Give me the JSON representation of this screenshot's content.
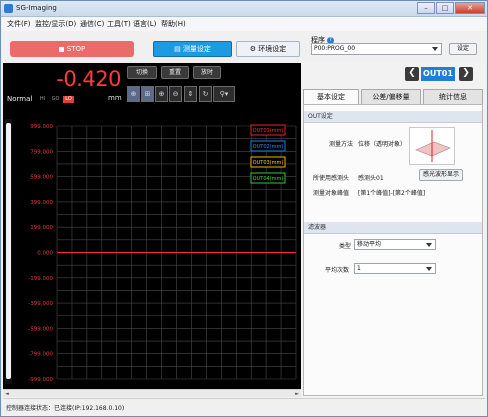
{
  "window": {
    "title": "SG-Imaging",
    "min": "–",
    "max": "□",
    "close": "✕"
  },
  "menu": [
    "文件(F)",
    "监控/显示(D)",
    "通信(C)",
    "工具(T)",
    "语言(L)",
    "帮助(H)"
  ],
  "toolbar": {
    "stop_label": "STOP",
    "measure_label": "测量设定",
    "env_label": "环境设定",
    "program_label": "程序",
    "program_help": "?",
    "program_value": "P00:PROG_00",
    "set_label": "设定"
  },
  "display": {
    "value": "-0.420",
    "unit": "mm",
    "mode": "Normal",
    "levels": [
      "HI",
      "GO",
      "LO"
    ],
    "active_level": "LO"
  },
  "chart_buttons": [
    "切换",
    "重置",
    "放时"
  ],
  "zoom_buttons": [
    "zoom-in-x",
    "zoom-fit",
    "zoom-in",
    "zoom-out",
    "range",
    "refresh",
    "cursor"
  ],
  "nav": {
    "prev": "❮",
    "next": "❯",
    "current": "OUT01"
  },
  "tabs": [
    "基本设定",
    "公差/偏移量",
    "统计信息"
  ],
  "out_settings": {
    "header": "OUT设定",
    "method_label": "测量方法",
    "method_value": "位移（透明对象）",
    "head_label": "所使用感测头",
    "head_value": "感测头01",
    "show_button": "感光波形显示",
    "peak_label": "测量对象峰值",
    "peak_value": "[第1个峰值]-[第2个峰值]"
  },
  "filter": {
    "header": "滤波器",
    "type_label": "类型",
    "type_value": "移动平均",
    "count_label": "平均次数",
    "count_value": "1"
  },
  "status": "控制器连接状态：已连接(IP:192.168.0.10)",
  "scroll": {
    "left": "◄",
    "right": "►"
  },
  "colors": {
    "accent_blue": "#1e9ae0",
    "stop_red": "#ed6a6a",
    "value_red": "#ff3a3a"
  },
  "chart_data": {
    "type": "line",
    "y_ticks": [
      "999.000",
      "799.000",
      "599.000",
      "399.000",
      "199.000",
      "0.000",
      "-199.000",
      "-399.000",
      "-599.000",
      "-799.000",
      "-999.000"
    ],
    "ylim": [
      -999,
      999
    ],
    "grid": true,
    "legend_position": "top-right",
    "series": [
      {
        "name": "OUT01(mm)",
        "color": "#ff2a2a",
        "values": [
          0,
          0,
          0,
          0,
          0,
          0,
          0,
          0,
          0,
          0
        ]
      },
      {
        "name": "OUT02(mm)",
        "color": "#1e90ff",
        "values": []
      },
      {
        "name": "OUT03(mm)",
        "color": "#ffcc00",
        "values": []
      },
      {
        "name": "OUT04(mm)",
        "color": "#3cdc3c",
        "values": []
      }
    ]
  }
}
